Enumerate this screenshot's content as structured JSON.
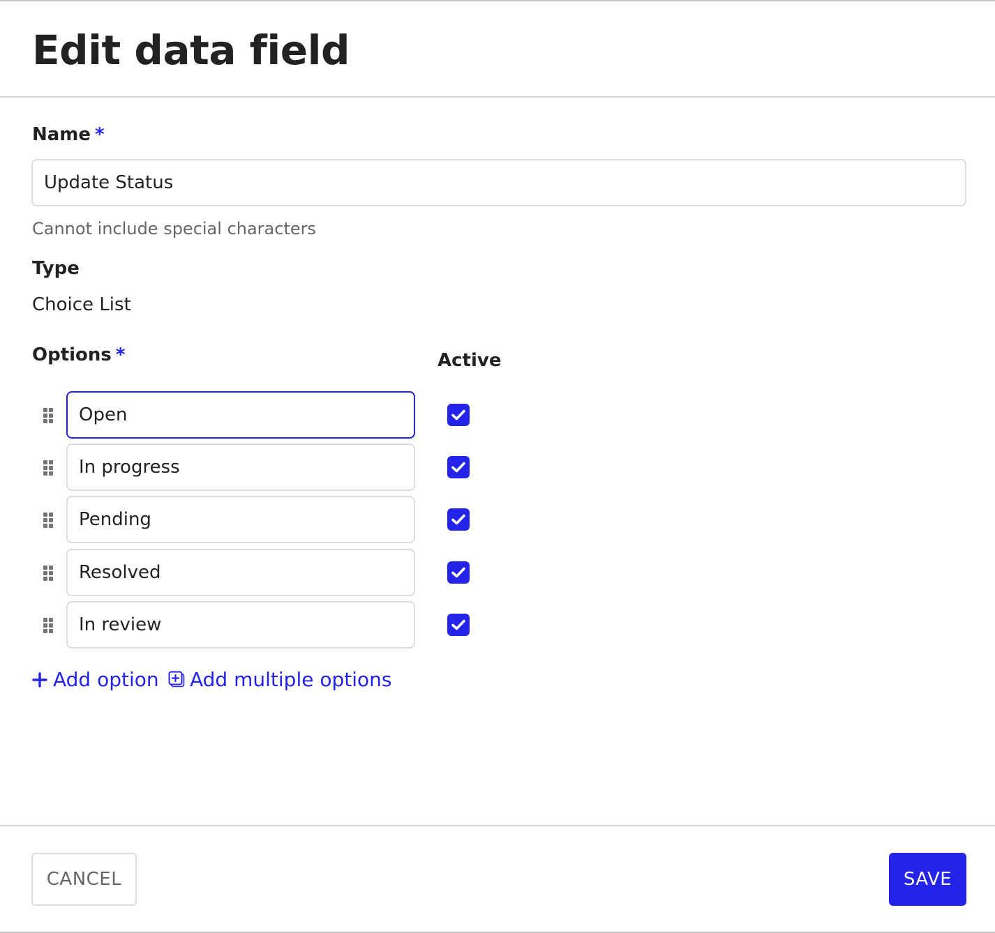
{
  "dialog": {
    "title": "Edit data field"
  },
  "name_field": {
    "label": "Name",
    "required_mark": "*",
    "value": "Update Status",
    "help_text": "Cannot include special characters"
  },
  "type_field": {
    "label": "Type",
    "value": "Choice List"
  },
  "options": {
    "label": "Options",
    "required_mark": "*",
    "active_header": "Active",
    "items": [
      {
        "value": "Open",
        "active": true,
        "focused": true
      },
      {
        "value": "In progress",
        "active": true,
        "focused": false
      },
      {
        "value": "Pending",
        "active": true,
        "focused": false
      },
      {
        "value": "Resolved",
        "active": true,
        "focused": false
      },
      {
        "value": "In review",
        "active": true,
        "focused": false
      }
    ],
    "add_option_label": "Add option",
    "add_option_icon": "plus-icon",
    "add_multiple_label": "Add multiple options",
    "add_multiple_icon": "add-multiple-icon"
  },
  "footer": {
    "cancel_label": "CANCEL",
    "save_label": "SAVE"
  },
  "colors": {
    "accent": "#2323ea",
    "text": "#222222",
    "muted": "#666666",
    "border": "#dcdcdc"
  }
}
